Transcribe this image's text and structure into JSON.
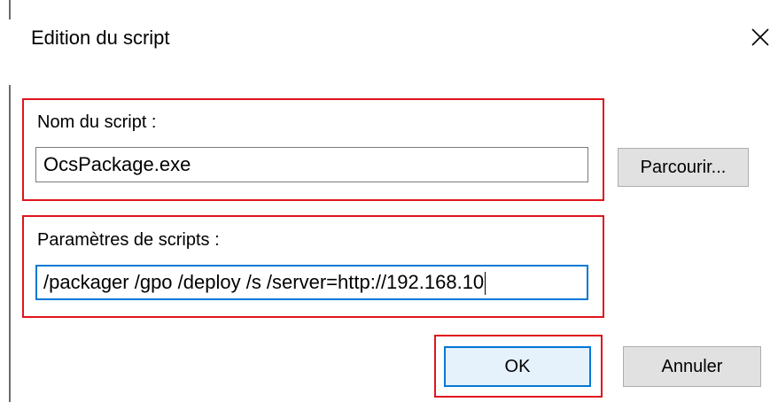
{
  "dialog": {
    "title": "Edition du script",
    "close_label": "Close"
  },
  "script_name": {
    "label": "Nom du script :",
    "value": "OcsPackage.exe",
    "browse_label": "Parcourir..."
  },
  "script_params": {
    "label": "Paramètres de scripts :",
    "value": "/packager /gpo /deploy /s  /server=http://192.168.10"
  },
  "footer": {
    "ok_label": "OK",
    "cancel_label": "Annuler"
  },
  "colors": {
    "highlight_red": "#e0141e",
    "focus_blue": "#0078d7"
  }
}
